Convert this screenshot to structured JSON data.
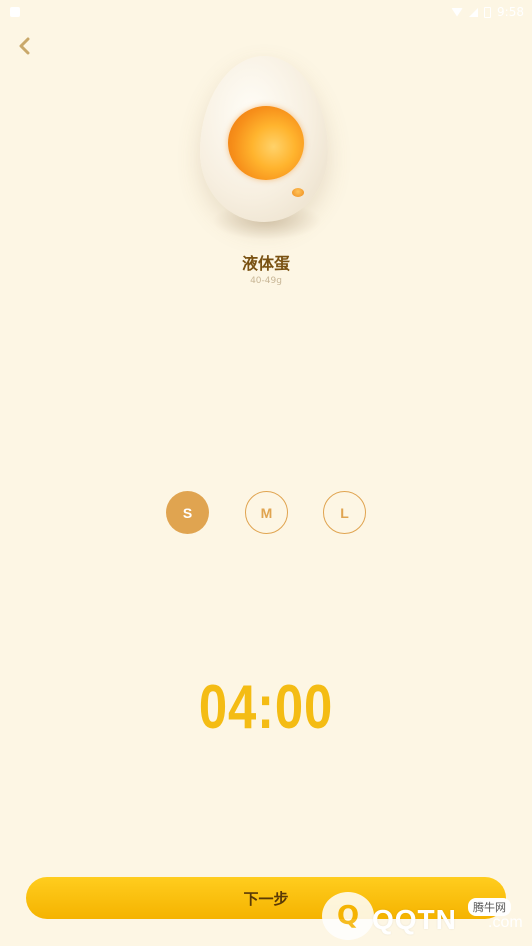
{
  "status_bar": {
    "time": "9:58"
  },
  "egg": {
    "name": "液体蛋",
    "weight": "40-49g"
  },
  "sizes": {
    "s": "S",
    "m": "M",
    "l": "L",
    "selected": "S"
  },
  "timer": {
    "value": "04:00"
  },
  "next_button": {
    "label": "下一步"
  },
  "watermark": {
    "logo_text": "Q",
    "text": "QQTN",
    "suffix": ".com",
    "badge": "腾牛网"
  },
  "colors": {
    "background": "#fdf6e4",
    "accent": "#e0a450",
    "timer": "#f4bc14",
    "button": "#ffc20e",
    "title": "#7a5212"
  },
  "icons": {
    "back": "chevron-left-icon"
  }
}
